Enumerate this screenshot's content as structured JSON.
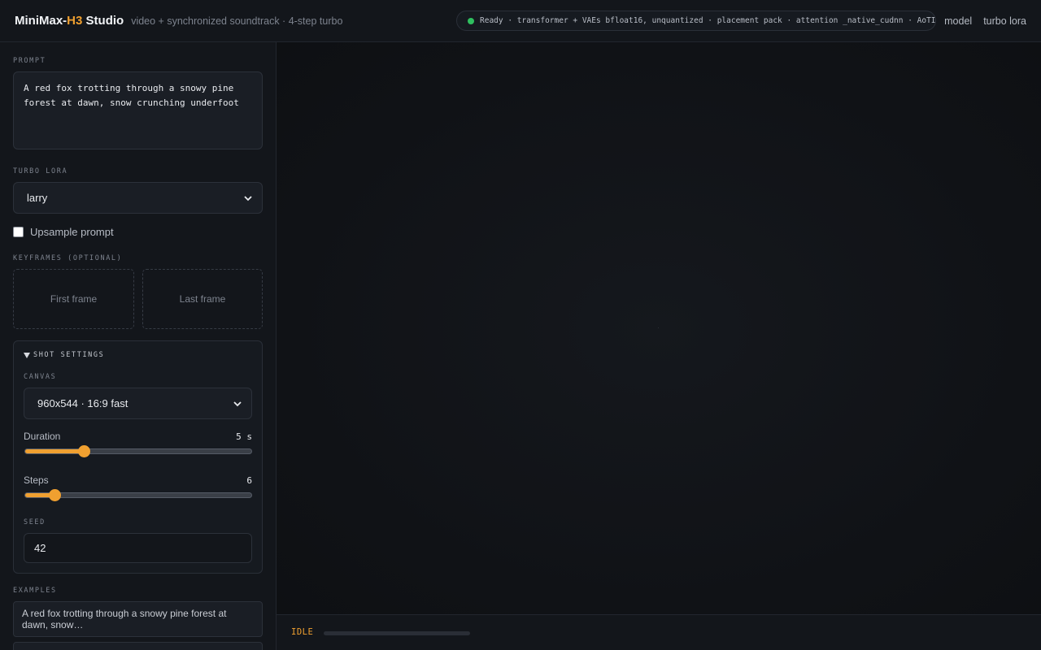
{
  "header": {
    "brand_prefix": "MiniMax-",
    "brand_accent": "H3",
    "brand_suffix": " Studio",
    "tagline": "video + synchronized soundtrack · 4-step turbo",
    "status_text": "Ready · transformer + VAEs bfloat16, unquantized · placement pack · attention _native_cudnn · AoTI on · r",
    "status_color": "#2fbf5f",
    "links": [
      "model",
      "turbo lora"
    ]
  },
  "sidebar": {
    "prompt_label": "PROMPT",
    "prompt_value": "A red fox trotting through a snowy pine forest at dawn, snow crunching underfoot",
    "lora_label": "TURBO LORA",
    "lora_value": "larry",
    "upsample_label": "Upsample prompt",
    "upsample_checked": false,
    "keyframes_label": "KEYFRAMES (OPTIONAL)",
    "first_frame": "First frame",
    "last_frame": "Last frame",
    "shot_settings": {
      "title": "SHOT SETTINGS",
      "canvas_label": "CANVAS",
      "canvas_value": "960x544 · 16:9 fast",
      "duration_label": "Duration",
      "duration_value": "5 s",
      "duration_fraction": 0.26,
      "steps_label": "Steps",
      "steps_value": "6",
      "steps_fraction": 0.13,
      "seed_label": "SEED",
      "seed_value": "42"
    },
    "examples_label": "EXAMPLES",
    "examples": [
      "A red fox trotting through a snowy pine forest at dawn, snow…"
    ]
  },
  "output": {
    "status": "IDLE",
    "progress_fraction": 0
  },
  "colors": {
    "accent": "#f0a030",
    "background": "#0f1115"
  }
}
